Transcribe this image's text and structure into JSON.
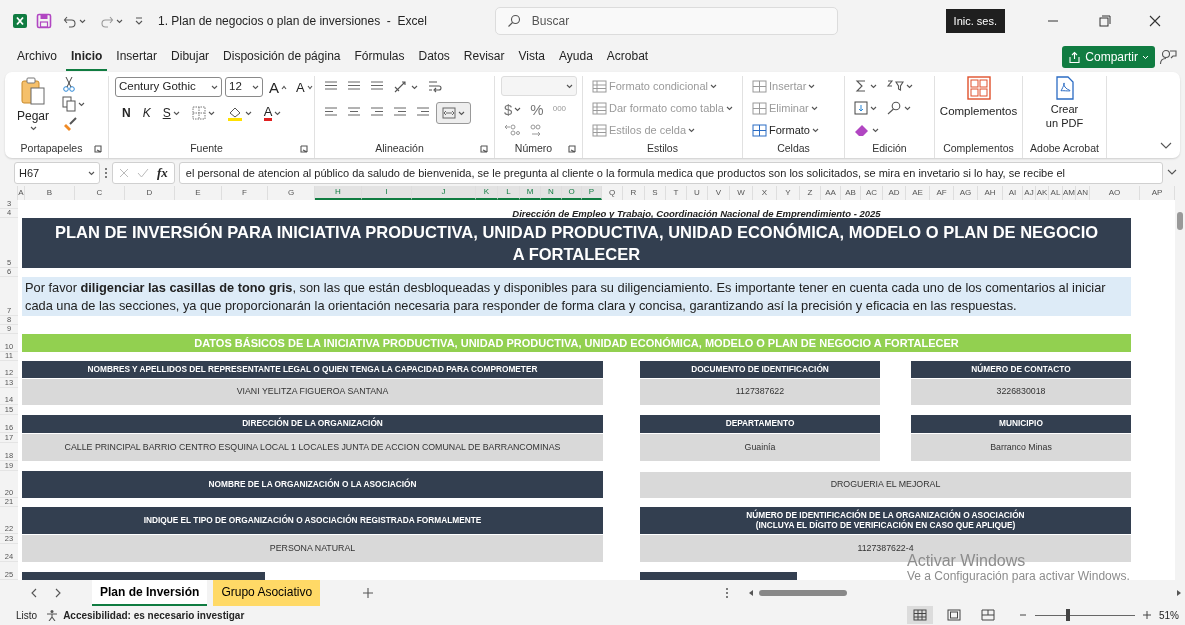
{
  "window": {
    "title": "1. Plan de negocios o plan de inversiones  -  Excel",
    "search_placeholder": "Buscar",
    "sign_in": "Inic. ses."
  },
  "ribbon_tabs": [
    {
      "label": "Archivo",
      "selected": false
    },
    {
      "label": "Inicio",
      "selected": true
    },
    {
      "label": "Insertar",
      "selected": false
    },
    {
      "label": "Dibujar",
      "selected": false
    },
    {
      "label": "Disposición de página",
      "selected": false
    },
    {
      "label": "Fórmulas",
      "selected": false
    },
    {
      "label": "Datos",
      "selected": false
    },
    {
      "label": "Revisar",
      "selected": false
    },
    {
      "label": "Vista",
      "selected": false
    },
    {
      "label": "Ayuda",
      "selected": false
    },
    {
      "label": "Acrobat",
      "selected": false
    }
  ],
  "share_button": "Compartir",
  "ribbon": {
    "clipboard": {
      "label": "Portapapeles",
      "paste": "Pegar"
    },
    "font": {
      "label": "Fuente",
      "font_name": "Century Gothic",
      "font_size": "12",
      "grow": "A",
      "shrink": "A",
      "bold": "N",
      "italic": "K",
      "underline": "S",
      "font_color": "A"
    },
    "alignment": {
      "label": "Alineación"
    },
    "number": {
      "label": "Número",
      "currency": "$",
      "percent": "%",
      "thousands": "000"
    },
    "styles": {
      "label": "Estilos",
      "items": [
        {
          "text": "Formato condicional",
          "disabled": true
        },
        {
          "text": "Dar formato como tabla",
          "disabled": true
        },
        {
          "text": "Estilos de celda",
          "disabled": true
        }
      ]
    },
    "cells": {
      "label": "Celdas",
      "items": [
        {
          "text": "Insertar",
          "disabled": true
        },
        {
          "text": "Eliminar",
          "disabled": true
        },
        {
          "text": "Formato",
          "disabled": false
        }
      ]
    },
    "editing": {
      "label": "Edición"
    },
    "addins": {
      "label": "Complementos",
      "button": "Complementos"
    },
    "acrobat": {
      "label": "Adobe Acrobat",
      "button": "Crear\nun PDF"
    }
  },
  "formula_bar": {
    "name_box": "H67",
    "fx": "fx",
    "content": "el personal de atencion al público da saludo de bienvenida, se le pregunta al cliente o la formula medica que productos son los solicitados, se mira en invetario si lo hay, se recibe el"
  },
  "columns": [
    {
      "label": "A",
      "selected": false
    },
    {
      "label": "B",
      "selected": false
    },
    {
      "label": "C",
      "selected": false
    },
    {
      "label": "D",
      "selected": false
    },
    {
      "label": "E",
      "selected": false
    },
    {
      "label": "F",
      "selected": false
    },
    {
      "label": "G",
      "selected": false
    },
    {
      "label": "H",
      "selected": true
    },
    {
      "label": "I",
      "selected": true
    },
    {
      "label": "J",
      "selected": true
    },
    {
      "label": "K",
      "selected": true
    },
    {
      "label": "L",
      "selected": true
    },
    {
      "label": "M",
      "selected": true
    },
    {
      "label": "N",
      "selected": true
    },
    {
      "label": "O",
      "selected": true
    },
    {
      "label": "P",
      "selected": true
    },
    {
      "label": "Q",
      "selected": false
    },
    {
      "label": "R",
      "selected": false
    },
    {
      "label": "S",
      "selected": false
    },
    {
      "label": "T",
      "selected": false
    },
    {
      "label": "U",
      "selected": false
    },
    {
      "label": "V",
      "selected": false
    },
    {
      "label": "W",
      "selected": false
    },
    {
      "label": "X",
      "selected": false
    },
    {
      "label": "Y",
      "selected": false
    },
    {
      "label": "Z",
      "selected": false
    },
    {
      "label": "AA",
      "selected": false
    },
    {
      "label": "AB",
      "selected": false
    },
    {
      "label": "AC",
      "selected": false
    },
    {
      "label": "AD",
      "selected": false
    },
    {
      "label": "AE",
      "selected": false
    },
    {
      "label": "AF",
      "selected": false
    },
    {
      "label": "AG",
      "selected": false
    },
    {
      "label": "AH",
      "selected": false
    },
    {
      "label": "AI",
      "selected": false
    },
    {
      "label": "AJ",
      "selected": false
    },
    {
      "label": "AK",
      "selected": false
    },
    {
      "label": "AL",
      "selected": false
    },
    {
      "label": "AM",
      "selected": false
    },
    {
      "label": "AN",
      "selected": false
    },
    {
      "label": "AO",
      "selected": false
    },
    {
      "label": "AP",
      "selected": false
    }
  ],
  "rows": [
    "3",
    "4",
    "5",
    "6",
    "7",
    "8",
    "9",
    "10",
    "11",
    "12",
    "13",
    "14",
    "15",
    "16",
    "17",
    "18",
    "19",
    "20",
    "21",
    "22",
    "23",
    "24",
    "25"
  ],
  "sheet": {
    "subheading": "Dirección de Empleo y Trabajo, Coordinación Nacional de Emprendimiento - 2025",
    "title": "PLAN DE INVERSIÓN PARA INICIATIVA PRODUCTIVA, UNIDAD PRODUCTIVA, UNIDAD ECONÓMICA, MODELO O PLAN DE NEGOCIO A FORTALECER",
    "intro": "Por favor **diligenciar las casillas de tono gris**, son las que están desbloqueadas y disponibles para su diligenciamiento. Es importante tener en cuenta cada uno de los comentarios al iniciar cada una de las secciones, ya que proporcionarán la orientación necesaria para responder de forma clara y concisa, garantizando así la precisión y eficacia en las respuestas.",
    "section": "DATOS BÁSICOS DE LA INICIATIVA PRODUCTIVA, UNIDAD PRODUCTIVA, UNIDAD ECONÓMICA, MODELO O PLAN DE NEGOCIO A FORTALECER",
    "form": [
      {
        "kind": "stacked",
        "fields": [
          {
            "label": "NOMBRES Y APELLIDOS DEL REPRESENTANTE LEGAL O QUIEN TENGA LA CAPACIDAD PARA COMPROMETER",
            "value": "VIANI YELITZA FIGUEROA SANTANA"
          },
          {
            "label": "DOCUMENTO DE IDENTIFICACIÓN",
            "value": "1127387622"
          },
          {
            "label": "NÚMERO DE CONTACTO",
            "value": "3226830018"
          }
        ]
      },
      {
        "kind": "stacked",
        "fields": [
          {
            "label": "DIRECCIÓN DE LA ORGANIZACIÓN",
            "value": "CALLE PRINCIPAL BARRIO CENTRO ESQUINA LOCAL 1 LOCALES JUNTA DE ACCION COMUNAL DE BARRANCOMINAS"
          },
          {
            "label": "DEPARTAMENTO",
            "value": "Guainía"
          },
          {
            "label": "MUNICIPIO",
            "value": "Barranco Minas"
          }
        ]
      },
      {
        "kind": "inline",
        "fields": [
          {
            "label": "NOMBRE DE LA ORGANIZACIÓN O LA ASOCIACIÓN",
            "value": "DROGUERIA EL MEJORAL"
          }
        ]
      },
      {
        "kind": "stacked",
        "fields": [
          {
            "label": "INDIQUE EL TIPO DE ORGANIZACIÓN O ASOCIACIÓN REGISTRADA FORMALMENTE",
            "value": "PERSONA NATURAL"
          },
          {
            "label": "NÚMERO DE IDENTIFICACIÓN DE LA ORGANIZACIÓN O ASOCIACIÓN\n(INCLUYA EL DÍGITO DE VERIFICACIÓN EN CASO QUE APLIQUE)",
            "value": "1127387622-4"
          }
        ]
      }
    ]
  },
  "sheet_tabs": [
    {
      "label": "Plan de Inversión",
      "selected": true
    },
    {
      "label": "Grupo Asociativo",
      "selected": false,
      "color": "#ffd966"
    }
  ],
  "status_bar": {
    "ready": "Listo",
    "accessibility": "Accesibilidad: es necesario investigar",
    "views": [
      {
        "kind": "normal",
        "selected": true
      },
      {
        "kind": "layout",
        "selected": false
      },
      {
        "kind": "pagebreak",
        "selected": false
      }
    ],
    "zoom": {
      "level": 0.32
    },
    "zoom_text": "51%"
  },
  "os_notice": {
    "title": "Activar Windows",
    "message": "Ve a Configuración para activar Windows."
  }
}
